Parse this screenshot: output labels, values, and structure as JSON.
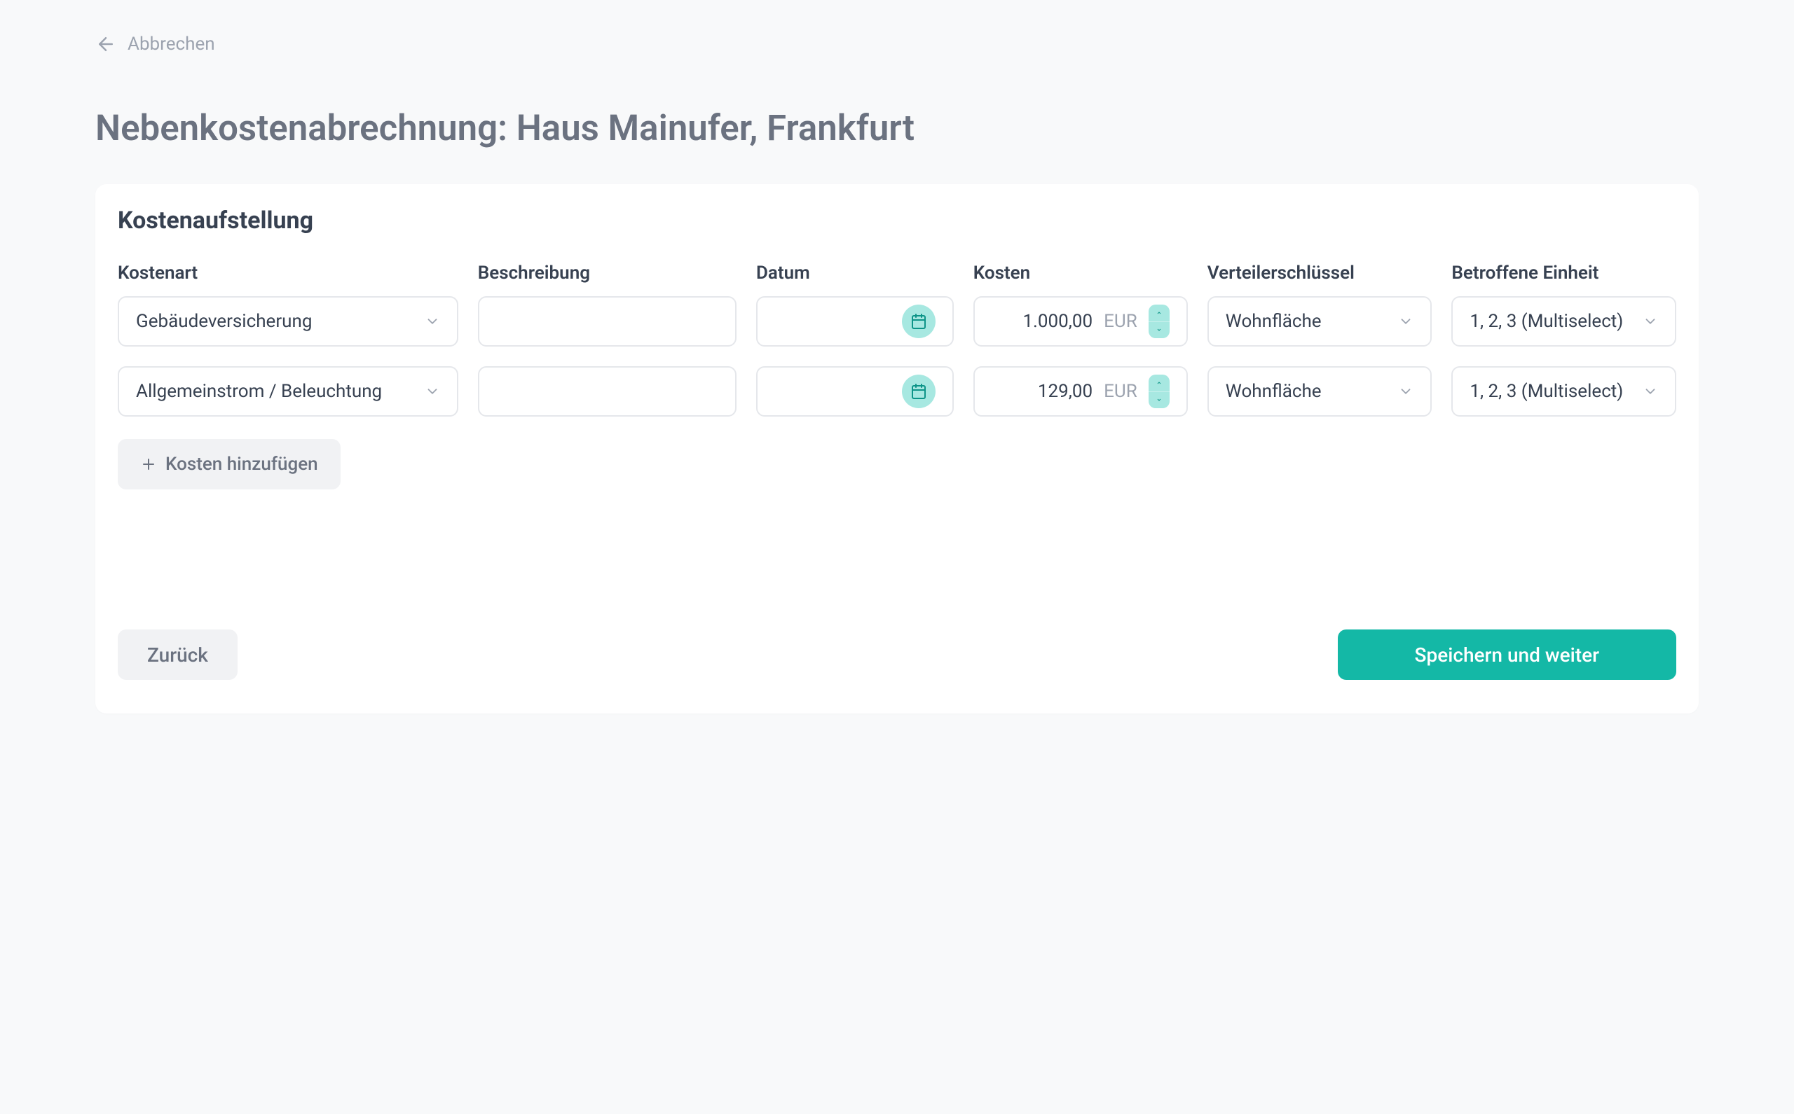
{
  "header": {
    "cancel_label": "Abbrechen"
  },
  "page_title": "Nebenkostenabrechnung: Haus Mainufer, Frankfurt",
  "card": {
    "title": "Kostenaufstellung",
    "columns": {
      "kostenart": "Kostenart",
      "beschreibung": "Beschreibung",
      "datum": "Datum",
      "kosten": "Kosten",
      "verteilerschluessel": "Verteilerschlüssel",
      "betroffene_einheit": "Betroffene Einheit"
    },
    "rows": [
      {
        "kostenart": "Gebäudeversicherung",
        "beschreibung": "",
        "datum": "",
        "kosten_value": "1.000,00",
        "kosten_currency": "EUR",
        "verteilerschluessel": "Wohnfläche",
        "betroffene_einheit": "1, 2, 3 (Multiselect)"
      },
      {
        "kostenart": "Allgemeinstrom / Beleuchtung",
        "beschreibung": "",
        "datum": "",
        "kosten_value": "129,00",
        "kosten_currency": "EUR",
        "verteilerschluessel": "Wohnfläche",
        "betroffene_einheit": "1, 2, 3 (Multiselect)"
      }
    ],
    "add_button_label": "Kosten hinzufügen"
  },
  "footer": {
    "back_label": "Zurück",
    "save_label": "Speichern und weiter"
  },
  "colors": {
    "primary": "#14b8a6",
    "accent_light": "#a7e8e1"
  }
}
